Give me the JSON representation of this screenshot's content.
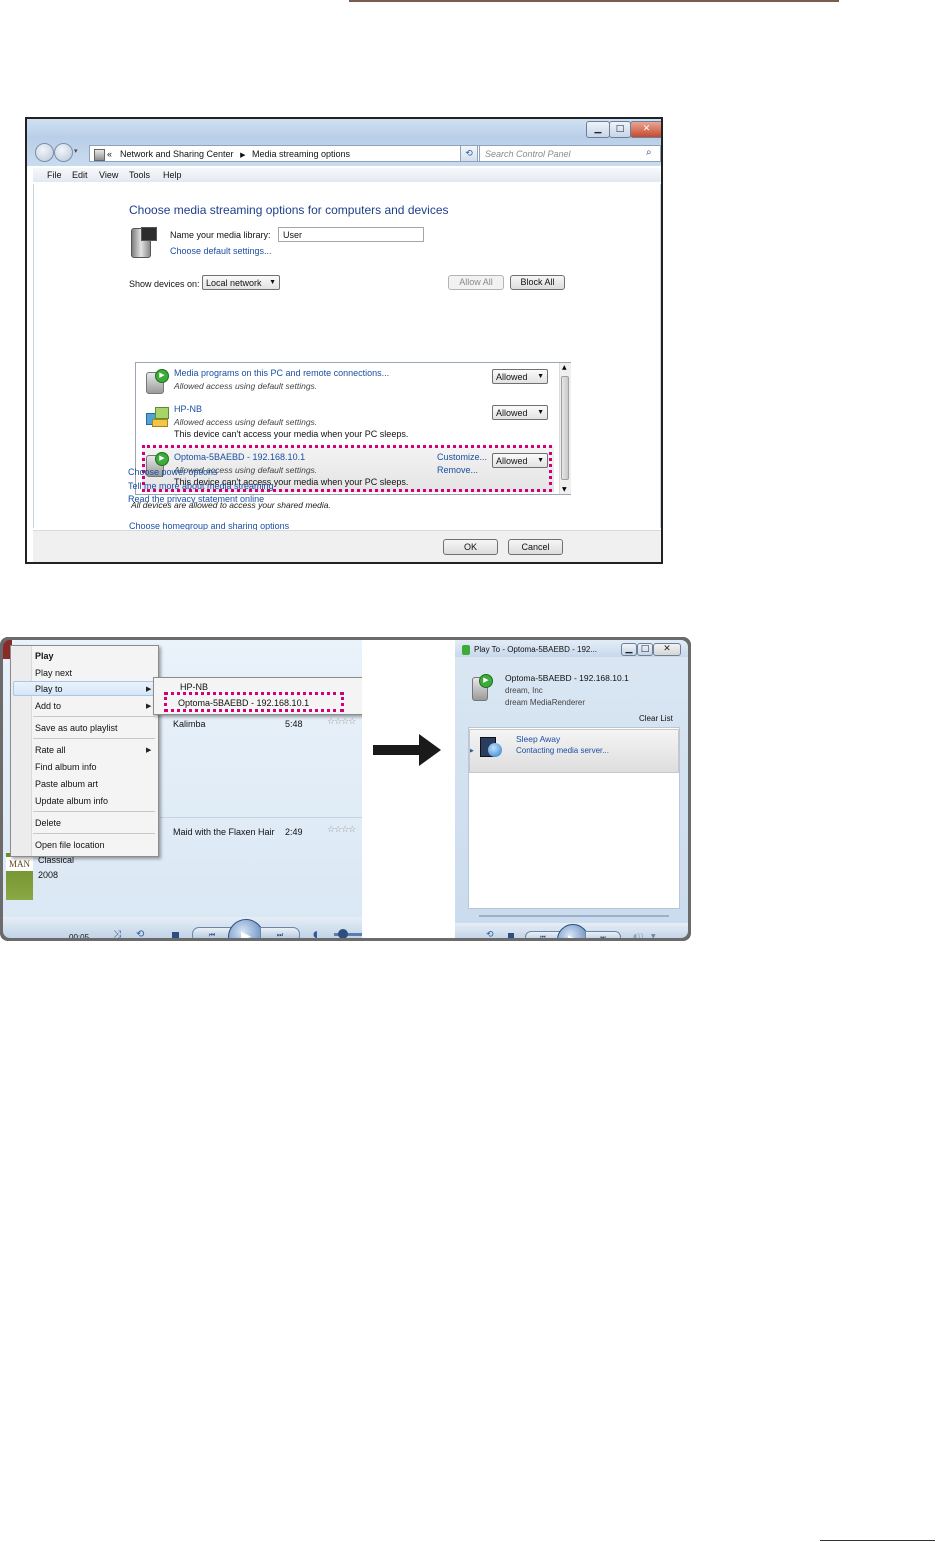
{
  "window1": {
    "address": {
      "crumb1": "Network and Sharing Center",
      "crumb2": "Media streaming options"
    },
    "search_placeholder": "Search Control Panel",
    "menu": [
      "File",
      "Edit",
      "View",
      "Tools",
      "Help"
    ],
    "heading": "Choose media streaming options for computers and devices",
    "library_label": "Name your media library:",
    "library_value": "User",
    "default_settings_link": "Choose default settings...",
    "show_devices_label": "Show devices on:",
    "show_devices_value": "Local network",
    "allow_all": "Allow All",
    "block_all": "Block All",
    "devices": [
      {
        "name": "Media programs on this PC and remote connections...",
        "status": "Allowed access using default settings.",
        "note": "",
        "permission": "Allowed"
      },
      {
        "name": "HP-NB",
        "status": "Allowed access using default settings.",
        "note": "This device can't access your media when your PC sleeps.",
        "permission": "Allowed"
      },
      {
        "name": "Optoma-5BAEBD - 192.168.10.1",
        "status": "Allowed access using default settings.",
        "note": "This device can't access your media when your PC sleeps.",
        "permission": "Allowed",
        "customize": "Customize...",
        "remove": "Remove..."
      }
    ],
    "all_allowed_note": "All devices are allowed to access your shared media.",
    "links": [
      "Choose homegroup and sharing options",
      "Choose power options",
      "Tell me more about media streaming",
      "Read the privacy statement online"
    ],
    "ok": "OK",
    "cancel": "Cancel"
  },
  "player": {
    "context_menu": [
      "Play",
      "Play next",
      "Play to",
      "Add to",
      "Save as auto playlist",
      "Rate all",
      "Find album info",
      "Paste album art",
      "Update album info",
      "Delete",
      "Open file location"
    ],
    "submenu": [
      "HP-NB",
      "Optoma-5BAEBD - 192.168.10.1"
    ],
    "tracks": [
      {
        "title": "Kalimba",
        "length": "5:48"
      },
      {
        "title": "Maid with the Flaxen Hair",
        "length": "2:49"
      }
    ],
    "album_genre": "Classical",
    "album_year": "2008",
    "album_art_text": "MAN",
    "time": "00:05"
  },
  "playto": {
    "title": "Play To - Optoma-5BAEBD - 192...",
    "device_name": "Optoma-5BAEBD - 192.168.10.1",
    "manufacturer": "dream, Inc",
    "model": "dream MediaRenderer",
    "clear_list": "Clear List",
    "track": "Sleep Away",
    "track_status": "Contacting media server..."
  }
}
